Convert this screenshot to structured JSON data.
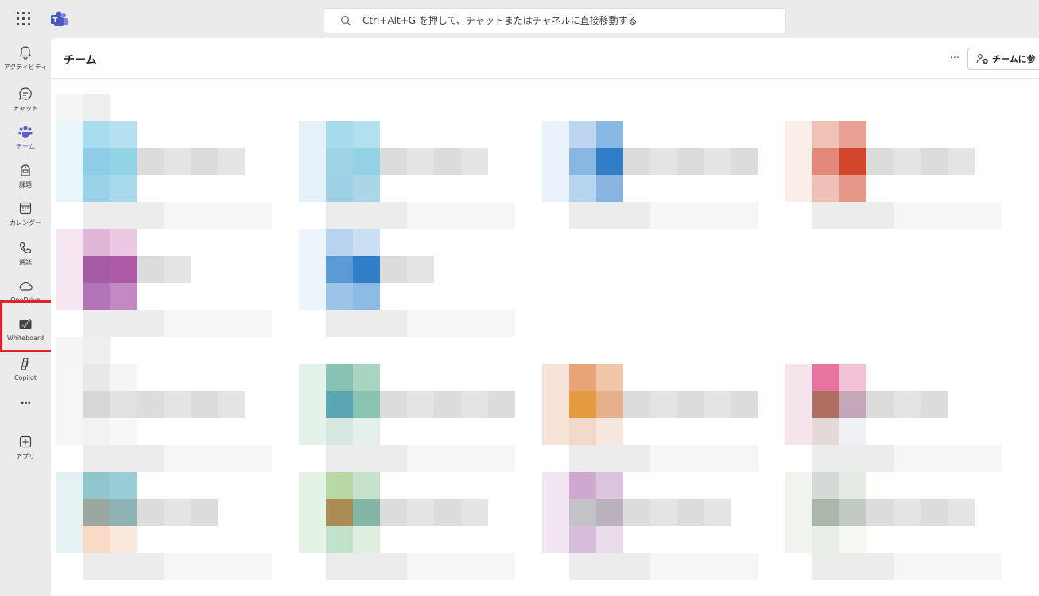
{
  "topbar": {
    "apps_icon": "apps-grid-icon",
    "logo_icon": "teams-logo-icon",
    "search_placeholder": "Ctrl+Alt+G を押して、チャットまたはチャネルに直接移動する"
  },
  "rail": {
    "items": [
      {
        "label": "アクティビティ",
        "icon": "bell-icon"
      },
      {
        "label": "チャット",
        "icon": "chat-icon"
      },
      {
        "label": "チーム",
        "icon": "teams-icon"
      },
      {
        "label": "課題",
        "icon": "assignments-icon"
      },
      {
        "label": "カレンダー",
        "icon": "calendar-icon"
      },
      {
        "label": "通話",
        "icon": "phone-icon"
      },
      {
        "label": "OneDrive",
        "icon": "cloud-icon"
      },
      {
        "label": "Whiteboard",
        "icon": "whiteboard-icon"
      },
      {
        "label": "Copilot",
        "icon": "copilot-icon"
      },
      {
        "label": "",
        "icon": "more-icon"
      },
      {
        "label": "アプリ",
        "icon": "add-app-icon"
      }
    ],
    "active": "チーム",
    "more_glyph": "···"
  },
  "main": {
    "title": "チーム",
    "more_glyph": "···",
    "join_button": "チームに参"
  },
  "colors": {
    "accent": "#5b5fc7",
    "highlight": "#e0232b"
  }
}
